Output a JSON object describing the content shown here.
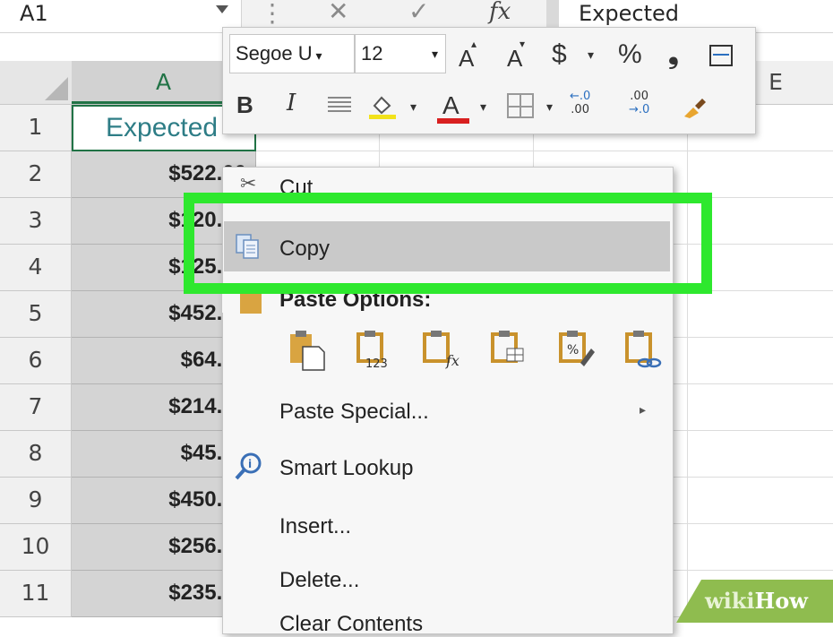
{
  "formula_bar": {
    "name_box": "A1",
    "cancel_glyph": "✕",
    "enter_glyph": "✓",
    "fx_label": "fx",
    "content": "Expected"
  },
  "columns": [
    "A",
    "E"
  ],
  "rows": [
    "1",
    "2",
    "3",
    "4",
    "5",
    "6",
    "7",
    "8",
    "9",
    "10",
    "11"
  ],
  "cells": {
    "A1": "Expected",
    "A": [
      "$522.00",
      "$120.00",
      "$125.00",
      "$452.00",
      "$64.00",
      "$214.00",
      "$45.00",
      "$450.00",
      "$256.00",
      "$235.00"
    ]
  },
  "mini_toolbar": {
    "font_name": "Segoe U",
    "font_size": "12",
    "increase_font": "A",
    "decrease_font": "A",
    "currency": "$",
    "percent": "%",
    "comma": "❟",
    "bold": "B",
    "italic": "I",
    "font_color": "A",
    "inc_decimal_top": "←.0",
    "inc_decimal_bottom": ".00",
    "dec_decimal_top": ".00",
    "dec_decimal_bottom": "→.0"
  },
  "context_menu": {
    "cut_label": "Cut",
    "copy_label": "Copy",
    "paste_options_label": "Paste Options:",
    "paste_special_label": "Paste Special...",
    "smart_lookup_label": "Smart Lookup",
    "insert_label": "Insert...",
    "delete_label": "Delete...",
    "clear_contents_label": "Clear Contents",
    "paste_icons": [
      "paste-icon",
      "paste-values-icon",
      "paste-formulas-icon",
      "paste-transpose-icon",
      "paste-formatting-icon",
      "paste-link-icon"
    ],
    "paste_values_caption": "123",
    "paste_formula_caption": "fx"
  },
  "watermark": {
    "wiki": "wiki",
    "how": "How"
  },
  "colors": {
    "excel_green": "#217346",
    "highlight_green": "#2ee82e",
    "selected_header_text": "#2e7d86",
    "wikihow_green": "#8fbc4f"
  }
}
